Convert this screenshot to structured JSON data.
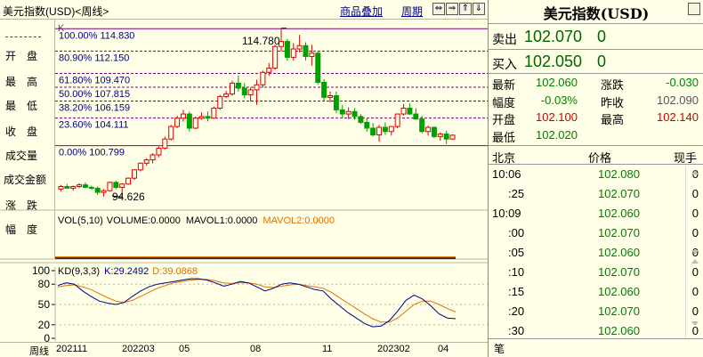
{
  "window": {
    "title": "美元指数(USD)<周线>",
    "links": [
      "商品叠加",
      "周期"
    ],
    "buttons": [
      "⇔",
      "⇒",
      "⇑",
      "⇓",
      "□"
    ]
  },
  "left_panel": {
    "labels": [
      "开　盘",
      "最　高",
      "最　低",
      "收　盘",
      "成交量",
      "成交金额",
      "涨　跌",
      "幅　度"
    ]
  },
  "chart_header": "K",
  "fib_levels": [
    {
      "label": "100.00% 114.830",
      "price": 114.83
    },
    {
      "label": "80.90% 112.150",
      "price": 112.15
    },
    {
      "label": "61.80% 109.470",
      "price": 109.47
    },
    {
      "label": "50.00% 107.815",
      "price": 107.815
    },
    {
      "label": "38.20% 106.159",
      "price": 106.159
    },
    {
      "label": "23.60% 104.111",
      "price": 104.111
    },
    {
      "label": "0.00% 100.799",
      "price": 100.799
    }
  ],
  "annotations": {
    "high": "114.780",
    "low": "94.626"
  },
  "volume_panel": {
    "title": "VOL(5,10)",
    "volume": "VOLUME:0.0000",
    "mavol1": "MAVOL1:0.0000",
    "mavol2": "MAVOL2:0.0000",
    "mavol2_color": "#e07000"
  },
  "kd_panel": {
    "title": "KD(9,3,3)",
    "k": "K:29.2492",
    "d": "D:39.0868",
    "k_color": "#000080",
    "d_color": "#e07000",
    "yticks": [
      "100",
      "80",
      "50",
      "20",
      "0"
    ]
  },
  "x_axis": {
    "period_label": "周线",
    "ticks": [
      "202111",
      "202203",
      "05",
      "08",
      "11",
      "202302",
      "04"
    ]
  },
  "right_panel": {
    "title": "美元指数(USD)",
    "sell_label": "卖出",
    "sell_value": "102.070",
    "sell_vol": "0",
    "buy_label": "买入",
    "buy_value": "102.050",
    "buy_vol": "0",
    "stats": [
      {
        "l1": "最新",
        "v1": "102.060",
        "c1": "green",
        "l2": "涨跌",
        "v2": "-0.030",
        "c2": "green"
      },
      {
        "l1": "幅度",
        "v1": "-0.03%",
        "c1": "green",
        "l2": "昨收",
        "v2": "102.090",
        "c2": "grey"
      },
      {
        "l1": "开盘",
        "v1": "102.100",
        "c1": "red",
        "l2": "最高",
        "v2": "102.140",
        "c2": "red"
      },
      {
        "l1": "最低",
        "v1": "102.020",
        "c1": "green",
        "l2": "",
        "v2": "",
        "c2": "grey"
      }
    ],
    "tick_header": [
      "北京",
      "价格",
      "现手"
    ],
    "ticks": [
      {
        "time": "10:06",
        "price": "102.080",
        "vol": "0"
      },
      {
        "time": ":25",
        "price": "102.070",
        "vol": "0"
      },
      {
        "time": "10:09",
        "price": "102.060",
        "vol": "0"
      },
      {
        "time": ":00",
        "price": "102.070",
        "vol": "0"
      },
      {
        "time": ":05",
        "price": "102.060",
        "vol": "0"
      },
      {
        "time": ":10",
        "price": "102.070",
        "vol": "0"
      },
      {
        "time": ":15",
        "price": "102.060",
        "vol": "0"
      },
      {
        "time": ":20",
        "price": "102.070",
        "vol": "0"
      },
      {
        "time": ":30",
        "price": "102.060",
        "vol": "0"
      }
    ],
    "bottom_tab": "笔"
  },
  "colors": {
    "up": "#e00000",
    "down": "#00a000",
    "fib_line": "#800080",
    "fib_dash": "#800080"
  },
  "chart_data": {
    "type": "candlestick",
    "ylim": [
      93.5,
      115.5
    ],
    "candles": [
      [
        95.6,
        96.1,
        95.3,
        95.9
      ],
      [
        95.9,
        96.2,
        95.6,
        95.7
      ],
      [
        95.7,
        96.0,
        95.4,
        95.9
      ],
      [
        95.9,
        96.3,
        95.7,
        96.1
      ],
      [
        96.1,
        96.4,
        95.7,
        95.8
      ],
      [
        95.8,
        96.0,
        95.5,
        95.7
      ],
      [
        95.7,
        95.9,
        94.9,
        95.2
      ],
      [
        95.2,
        95.6,
        94.7,
        95.4
      ],
      [
        95.4,
        96.5,
        95.3,
        96.4
      ],
      [
        96.4,
        96.6,
        95.6,
        95.8
      ],
      [
        95.8,
        96.3,
        94.63,
        96.2
      ],
      [
        96.2,
        97.0,
        96.1,
        96.9
      ],
      [
        96.9,
        98.0,
        96.7,
        97.9
      ],
      [
        97.9,
        98.8,
        97.7,
        98.7
      ],
      [
        98.7,
        99.3,
        98.4,
        99.1
      ],
      [
        99.1,
        99.9,
        98.7,
        99.7
      ],
      [
        99.7,
        100.7,
        99.4,
        100.5
      ],
      [
        100.5,
        101.9,
        100.3,
        101.6
      ],
      [
        101.6,
        103.3,
        101.4,
        103.1
      ],
      [
        103.1,
        104.4,
        102.9,
        104.1
      ],
      [
        104.1,
        105.1,
        103.7,
        104.6
      ],
      [
        104.6,
        104.9,
        102.5,
        102.9
      ],
      [
        102.9,
        104.3,
        102.8,
        104.1
      ],
      [
        104.1,
        104.8,
        103.9,
        104.3
      ],
      [
        104.3,
        104.9,
        103.7,
        104.1
      ],
      [
        104.1,
        105.5,
        104.0,
        105.3
      ],
      [
        105.3,
        106.9,
        105.1,
        106.7
      ],
      [
        106.7,
        107.4,
        106.5,
        107.0
      ],
      [
        107.0,
        108.6,
        106.8,
        108.3
      ],
      [
        108.3,
        109.2,
        107.3,
        107.7
      ],
      [
        107.7,
        108.3,
        106.5,
        106.9
      ],
      [
        106.9,
        107.8,
        106.1,
        107.5
      ],
      [
        107.5,
        108.7,
        105.7,
        108.1
      ],
      [
        108.1,
        109.8,
        107.8,
        109.6
      ],
      [
        109.6,
        110.7,
        109.2,
        110.1
      ],
      [
        110.1,
        112.9,
        109.9,
        112.7
      ],
      [
        112.7,
        114.78,
        112.1,
        113.3
      ],
      [
        113.3,
        113.6,
        111.0,
        111.4
      ],
      [
        111.4,
        113.1,
        111.0,
        112.4
      ],
      [
        112.4,
        114.1,
        112.0,
        112.8
      ],
      [
        112.8,
        113.2,
        111.0,
        111.5
      ],
      [
        111.5,
        112.9,
        110.4,
        111.9
      ],
      [
        111.9,
        112.2,
        108.1,
        108.4
      ],
      [
        108.4,
        108.8,
        106.2,
        106.6
      ],
      [
        106.6,
        107.3,
        106.0,
        106.8
      ],
      [
        106.8,
        107.3,
        104.7,
        105.1
      ],
      [
        105.1,
        105.7,
        104.1,
        104.6
      ],
      [
        104.6,
        105.4,
        104.0,
        104.9
      ],
      [
        104.9,
        105.3,
        103.9,
        104.3
      ],
      [
        104.3,
        104.6,
        103.4,
        103.6
      ],
      [
        103.6,
        104.1,
        102.5,
        102.9
      ],
      [
        102.9,
        103.5,
        101.9,
        102.1
      ],
      [
        102.1,
        103.3,
        101.3,
        103.0
      ],
      [
        103.0,
        103.6,
        102.1,
        102.5
      ],
      [
        102.5,
        103.1,
        102.0,
        103.1
      ],
      [
        103.1,
        104.6,
        102.9,
        104.6
      ],
      [
        104.6,
        105.8,
        104.4,
        105.3
      ],
      [
        105.3,
        105.9,
        104.5,
        104.6
      ],
      [
        104.6,
        105.3,
        103.9,
        104.0
      ],
      [
        104.0,
        104.4,
        102.3,
        102.5
      ],
      [
        102.5,
        103.2,
        102.0,
        103.0
      ],
      [
        103.0,
        103.1,
        101.7,
        101.9
      ],
      [
        101.9,
        102.4,
        101.4,
        102.2
      ],
      [
        102.2,
        102.6,
        101.0,
        101.6
      ],
      [
        101.6,
        102.14,
        101.5,
        102.06
      ]
    ],
    "kd": {
      "k": [
        78,
        82,
        80,
        70,
        62,
        55,
        52,
        50,
        53,
        62,
        70,
        76,
        80,
        82,
        84,
        86,
        88,
        88,
        86,
        82,
        77,
        80,
        84,
        82,
        76,
        70,
        74,
        80,
        82,
        80,
        76,
        72,
        70,
        58,
        48,
        38,
        30,
        22,
        17,
        18,
        26,
        40,
        56,
        64,
        58,
        48,
        36,
        30,
        29
      ],
      "d": [
        76,
        78,
        79,
        76,
        72,
        66,
        60,
        55,
        53,
        56,
        62,
        68,
        74,
        78,
        82,
        84,
        86,
        87,
        87,
        85,
        82,
        81,
        82,
        82,
        80,
        76,
        75,
        77,
        79,
        80,
        78,
        76,
        74,
        68,
        60,
        52,
        44,
        36,
        29,
        24,
        24,
        30,
        40,
        50,
        55,
        55,
        50,
        44,
        39
      ]
    }
  }
}
